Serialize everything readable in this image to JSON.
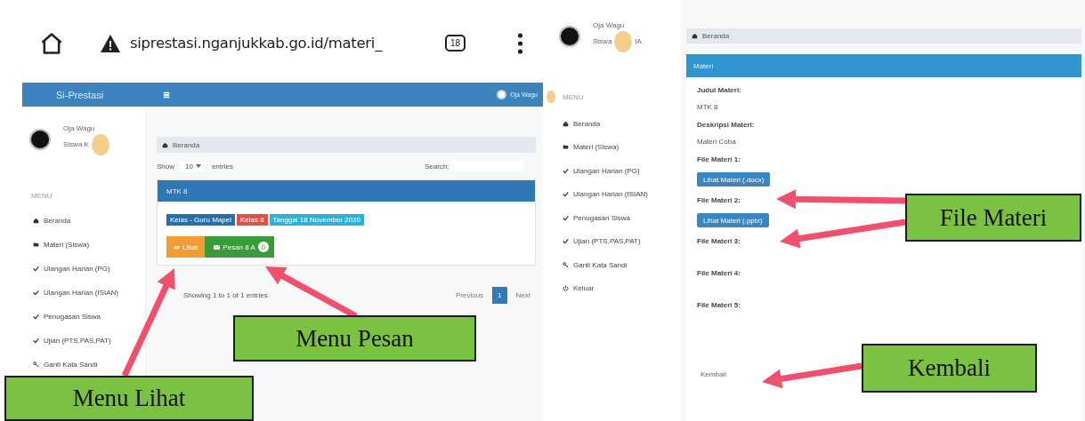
{
  "left_screen": {
    "browser": {
      "url": "siprestasi.nganjukkab.go.id/materi_",
      "tab_count": "18"
    },
    "header": {
      "brand": "Si-Prestasi",
      "user": "Oja Wagu"
    },
    "sidebar": {
      "profile_name": "Oja Wagu",
      "profile_role": "Siswa K",
      "menu_label": "MENU",
      "items": [
        {
          "kind": "home",
          "label": "Beranda"
        },
        {
          "kind": "folder",
          "label": "Materi (Siswa)"
        },
        {
          "kind": "check",
          "label": "Ulangan Harian (PG)"
        },
        {
          "kind": "check",
          "label": "Ulangan Harian (ISIAN)"
        },
        {
          "kind": "check",
          "label": "Penugasan Siswa"
        },
        {
          "kind": "check",
          "label": "Ujian (PTS,PAS,PAT)"
        },
        {
          "kind": "key",
          "label": "Ganti Kata Sandi"
        }
      ]
    },
    "breadcrumb": "Beranda",
    "show_label": "Show",
    "entries_value": "10",
    "entries_label": "entries",
    "search_label": "Search:",
    "card": {
      "title": "MTK 8",
      "tags": [
        {
          "label": "Kelas - Guru Mapel",
          "color": "#2b6ea6"
        },
        {
          "label": "Kelas 8",
          "color": "#d9534f"
        },
        {
          "label": "Tanggal 18 November 2020",
          "color": "#31b0d5"
        }
      ],
      "buttons": [
        {
          "kind": "view",
          "label": "Lihat"
        },
        {
          "kind": "message",
          "label": "Pesan 8 A",
          "badge": "0"
        }
      ]
    },
    "info": "Showing 1 to 1 of 1 entries",
    "pagination": [
      {
        "label": "Previous",
        "selected": false
      },
      {
        "label": "1",
        "selected": true
      },
      {
        "label": "Next",
        "selected": false
      }
    ]
  },
  "right_screen": {
    "sidebar": {
      "profile_name": "Oja Wagu",
      "profile_role": "Siswa",
      "profile_suffix": "IA",
      "menu_label": "MENU",
      "items": [
        {
          "kind": "home",
          "label": "Beranda"
        },
        {
          "kind": "folder",
          "label": "Materi (Siswa)"
        },
        {
          "kind": "check",
          "label": "Ulangan Harian (PG)"
        },
        {
          "kind": "check",
          "label": "Ulangan Harian (ISIAN)"
        },
        {
          "kind": "check",
          "label": "Penugasan Siswa"
        },
        {
          "kind": "check",
          "label": "Ujian (PTS,PAS,PAT)"
        },
        {
          "kind": "key",
          "label": "Ganti Kata Sandi"
        },
        {
          "kind": "power",
          "label": "Keluar"
        }
      ]
    },
    "breadcrumb": "Beranda",
    "panel_title": "Materi",
    "fields": [
      {
        "kind": "text",
        "label": "Judul Materi:",
        "value": "MTK 8"
      },
      {
        "kind": "text",
        "label": "Deskripsi Materi:",
        "value": "Materi Coba"
      },
      {
        "kind": "file",
        "label": "File Materi 1:",
        "button": "Lihat Materi (.docx)"
      },
      {
        "kind": "file",
        "label": "File Materi 2:",
        "button": "Lihat Materi (.pptx)"
      },
      {
        "kind": "file",
        "label": "File Materi 3:"
      },
      {
        "kind": "file",
        "label": "File Materi 4:"
      },
      {
        "kind": "file",
        "label": "File Materi 5:"
      }
    ],
    "back_link": "Kembali"
  },
  "callouts": [
    {
      "label": "Menu Pesan"
    },
    {
      "label": "Menu Lihat"
    },
    {
      "label": "File Materi"
    },
    {
      "label": "Kembali"
    }
  ]
}
